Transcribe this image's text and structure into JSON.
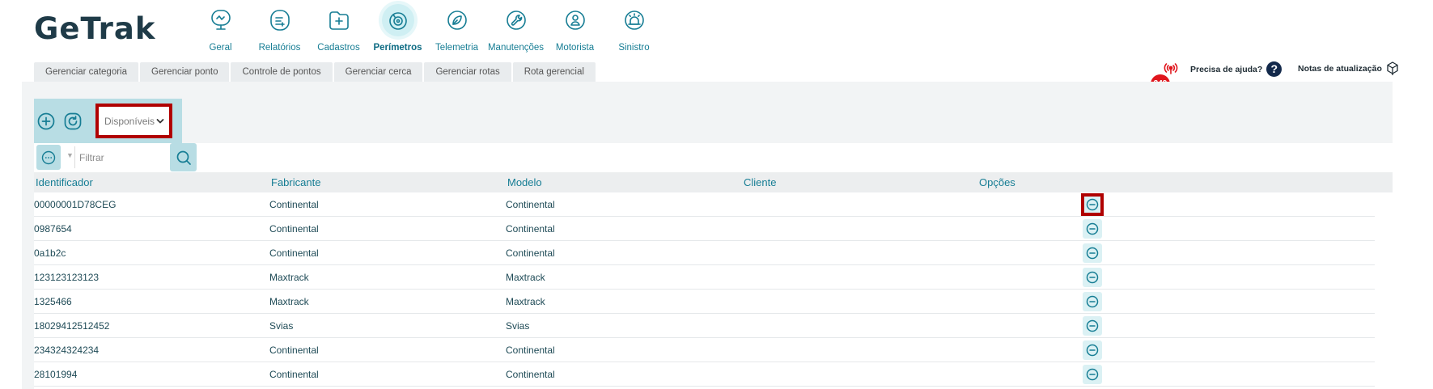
{
  "brand": {
    "logo_text": "GeTrak"
  },
  "nav": {
    "items": [
      {
        "label": "Geral",
        "icon": "monitor-icon"
      },
      {
        "label": "Relatórios",
        "icon": "report-icon"
      },
      {
        "label": "Cadastros",
        "icon": "folder-plus-icon"
      },
      {
        "label": "Perímetros",
        "icon": "perimeter-icon",
        "active": true
      },
      {
        "label": "Telemetria",
        "icon": "leaf-icon"
      },
      {
        "label": "Manutenções",
        "icon": "wrench-icon"
      },
      {
        "label": "Motorista",
        "icon": "driver-icon"
      },
      {
        "label": "Sinistro",
        "icon": "siren-icon"
      }
    ]
  },
  "tabs": [
    "Gerenciar categoria",
    "Gerenciar ponto",
    "Controle de pontos",
    "Gerenciar cerca",
    "Gerenciar rotas",
    "Rota gerencial"
  ],
  "header_right": {
    "notification_count": "249",
    "help_label": "Precisa de ajuda?",
    "help_glyph": "?",
    "updates_label": "Notas de atualização"
  },
  "toolbar": {
    "status_select": "Disponíveis"
  },
  "filter": {
    "placeholder": "Filtrar"
  },
  "table": {
    "columns": [
      "Identificador",
      "Fabricante",
      "Modelo",
      "Cliente",
      "Opções"
    ],
    "rows": [
      {
        "identificador": "00000001D78CEG",
        "fabricante": "Continental",
        "modelo": "Continental",
        "cliente": ""
      },
      {
        "identificador": "0987654",
        "fabricante": "Continental",
        "modelo": "Continental",
        "cliente": ""
      },
      {
        "identificador": "0a1b2c",
        "fabricante": "Continental",
        "modelo": "Continental",
        "cliente": ""
      },
      {
        "identificador": "123123123123",
        "fabricante": "Maxtrack",
        "modelo": "Maxtrack",
        "cliente": ""
      },
      {
        "identificador": "1325466",
        "fabricante": "Maxtrack",
        "modelo": "Maxtrack",
        "cliente": ""
      },
      {
        "identificador": "18029412512452",
        "fabricante": "Svias",
        "modelo": "Svias",
        "cliente": ""
      },
      {
        "identificador": "234324324234",
        "fabricante": "Continental",
        "modelo": "Continental",
        "cliente": ""
      },
      {
        "identificador": "28101994",
        "fabricante": "Continental",
        "modelo": "Continental",
        "cliente": ""
      }
    ]
  },
  "colors": {
    "accent": "#167d94",
    "toolbar_bg": "#b8dde4",
    "highlight": "#b00000",
    "badge": "#e0161d"
  }
}
